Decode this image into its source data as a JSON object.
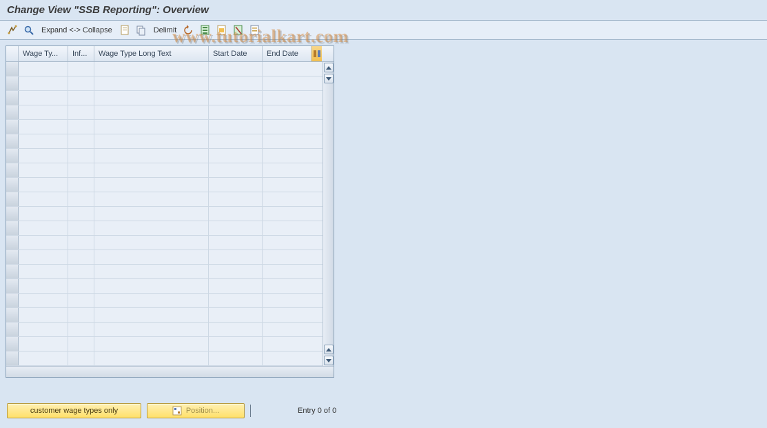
{
  "header": {
    "title": "Change View \"SSB Reporting\": Overview"
  },
  "toolbar": {
    "expand_collapse": "Expand <-> Collapse",
    "delimit": "Delimit"
  },
  "table": {
    "columns": {
      "wage_type": "Wage Ty...",
      "inf": "Inf...",
      "long_text": "Wage Type Long Text",
      "start_date": "Start Date",
      "end_date": "End Date"
    },
    "row_count": 21
  },
  "footer": {
    "customer_wage_types": "customer wage types only",
    "position": "Position...",
    "entry_status": "Entry 0 of 0"
  },
  "watermark": "www.tutorialkart.com"
}
